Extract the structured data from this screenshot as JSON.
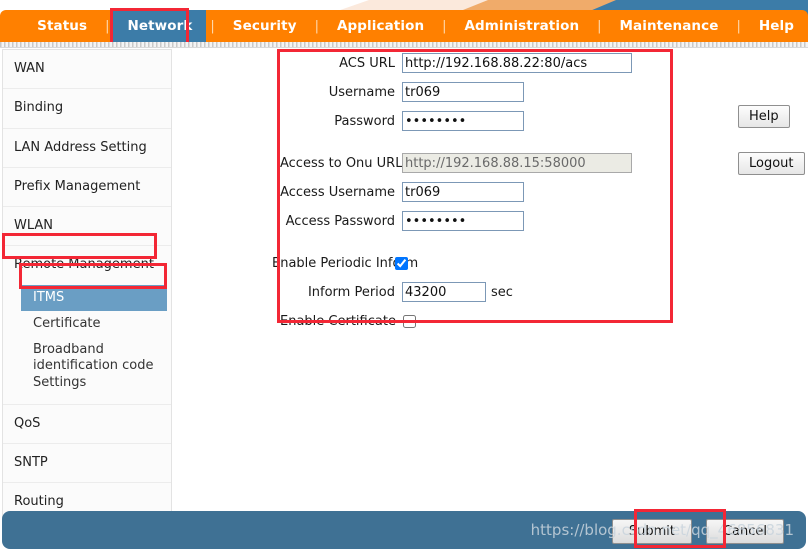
{
  "navbar": {
    "items": [
      {
        "label": "Status",
        "active": false
      },
      {
        "label": "Network",
        "active": true
      },
      {
        "label": "Security",
        "active": false
      },
      {
        "label": "Application",
        "active": false
      },
      {
        "label": "Administration",
        "active": false
      },
      {
        "label": "Maintenance",
        "active": false
      },
      {
        "label": "Help",
        "active": false
      }
    ],
    "separator": "|",
    "active_tab": "Network",
    "bar_color": "#ff8000",
    "active_tab_color": "#3c7ca8",
    "highlight_color": "#f32735"
  },
  "sidebar": {
    "items": [
      {
        "label": "WAN"
      },
      {
        "label": "Binding"
      },
      {
        "label": "LAN Address Setting"
      },
      {
        "label": "Prefix Management"
      },
      {
        "label": "WLAN"
      },
      {
        "label": "Remote Management"
      },
      {
        "label": "QoS"
      },
      {
        "label": "SNTP"
      },
      {
        "label": "Routing"
      }
    ],
    "sub_items": [
      {
        "label": "ITMS",
        "selected": true
      },
      {
        "label": "Certificate",
        "selected": false
      },
      {
        "label": "Broadband identification code Settings",
        "selected": false
      }
    ],
    "selected_color": "#6a9ec4"
  },
  "form": {
    "fields": [
      {
        "label": "ACS URL",
        "value": "http://192.168.88.22:80/acs",
        "type": "text",
        "disabled": false,
        "width": "long"
      },
      {
        "label": "Username",
        "value": "tr069",
        "type": "text",
        "disabled": false,
        "width": "mid"
      },
      {
        "label": "Password",
        "value": "password",
        "type": "password",
        "disabled": false,
        "width": "mid"
      },
      {
        "label": "Access to Onu URL",
        "value": "http://192.168.88.15:58000",
        "type": "text",
        "disabled": true,
        "width": "long"
      },
      {
        "label": "Access Username",
        "value": "tr069",
        "type": "text",
        "disabled": false,
        "width": "mid"
      },
      {
        "label": "Access Password",
        "value": "password",
        "type": "password",
        "disabled": false,
        "width": "mid"
      }
    ],
    "enable_periodic_inform": {
      "label": "Enable Periodic Inform",
      "checked": true
    },
    "inform_period": {
      "label": "Inform Period",
      "value": "43200",
      "unit": "sec"
    },
    "enable_certificate": {
      "label": "Enable Certificate",
      "checked": false
    }
  },
  "side_buttons": {
    "help": "Help",
    "logout": "Logout"
  },
  "footer": {
    "submit": "Submit",
    "cancel": "Cancel",
    "bar_color": "#3f7194",
    "watermark": "https://blog.csdn.net/qq_46856831"
  }
}
